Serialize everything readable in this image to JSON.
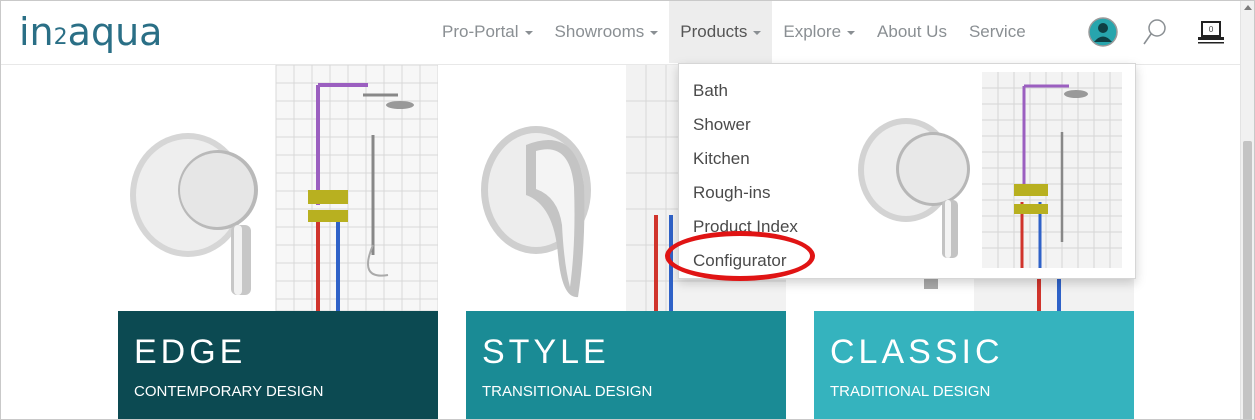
{
  "logo": {
    "pre": "in",
    "num": "2",
    "post": "aqua"
  },
  "nav": {
    "items": [
      {
        "label": "Pro-Portal"
      },
      {
        "label": "Showrooms"
      },
      {
        "label": "Products"
      },
      {
        "label": "Explore"
      },
      {
        "label": "About Us"
      },
      {
        "label": "Service"
      }
    ],
    "cart_count": "0"
  },
  "products_menu": {
    "items": [
      "Bath",
      "Shower",
      "Kitchen",
      "Rough-ins",
      "Product Index",
      "Configurator"
    ],
    "highlighted": "Configurator"
  },
  "cards": [
    {
      "title": "EDGE",
      "subtitle": "CONTEMPORARY DESIGN",
      "color": "#0c4a52"
    },
    {
      "title": "STYLE",
      "subtitle": "TRANSITIONAL DESIGN",
      "color": "#1a8b95"
    },
    {
      "title": "CLASSIC",
      "subtitle": "TRADITIONAL DESIGN",
      "color": "#35b3be"
    }
  ],
  "colors": {
    "brand": "#2a6f86",
    "highlight_ring": "#e01414",
    "avatar": "#27a5ad"
  }
}
